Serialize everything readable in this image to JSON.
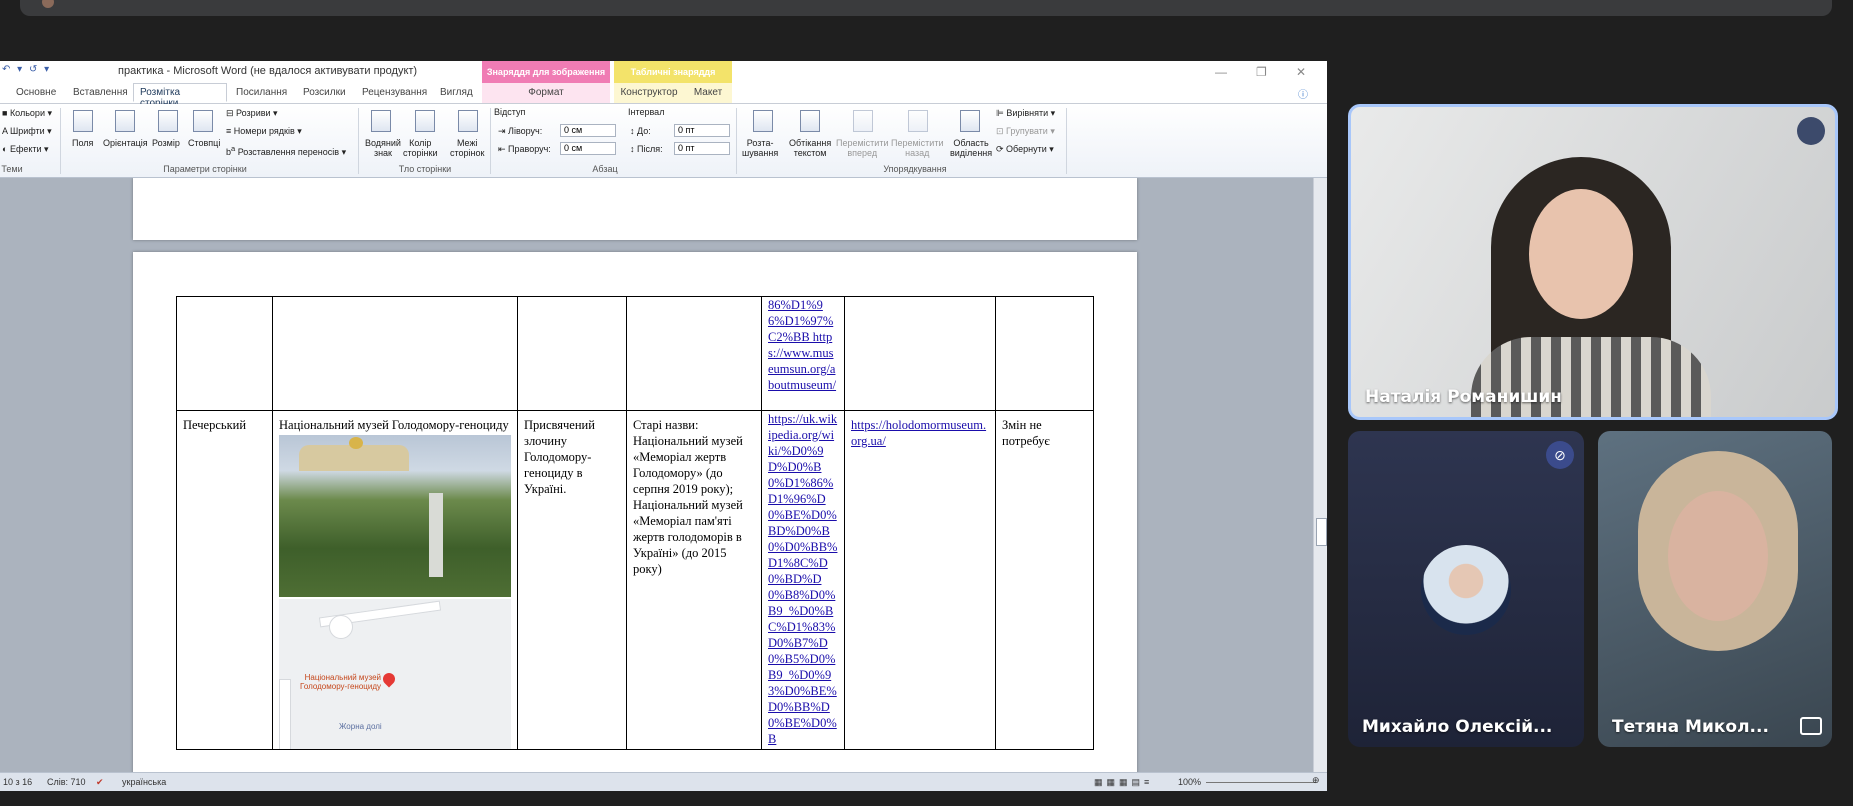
{
  "word": {
    "title": "практика - Microsoft Word (не вдалося активувати продукт)",
    "context_tabs": {
      "image_tools": "Знаряддя для зображення",
      "table_tools": "Табличні знаряддя"
    },
    "tabs": [
      "Основне",
      "Вставлення",
      "Розмітка сторінки",
      "Посилання",
      "Розсилки",
      "Рецензування",
      "Вигляд"
    ],
    "context_sub_tabs": [
      "Формат",
      "Конструктор",
      "Макет"
    ],
    "ribbon": {
      "themes": {
        "colors": "Кольори",
        "fonts": "Шрифти",
        "effects": "Ефекти",
        "group": "Теми"
      },
      "page_setup": {
        "margins": "Поля",
        "orientation": "Орієнтація",
        "size": "Розмір",
        "columns": "Стовпці",
        "breaks": "Розриви",
        "line_numbers": "Номери рядків",
        "hyphenation": "Розставлення переносів",
        "group": "Параметри сторінки"
      },
      "page_background": {
        "watermark": [
          "Водяний",
          "знак"
        ],
        "page_color": [
          "Колір",
          "сторінки"
        ],
        "page_borders": [
          "Межі",
          "сторінок"
        ],
        "group": "Тло сторінки"
      },
      "paragraph": {
        "indent_label": "Відступ",
        "left_label": "Ліворуч:",
        "left_value": "0 см",
        "right_label": "Праворуч:",
        "right_value": "0 см",
        "spacing_label": "Інтервал",
        "before_label": "До:",
        "before_value": "0 пт",
        "after_label": "Після:",
        "after_value": "0 пт",
        "group": "Абзац"
      },
      "arrange": {
        "position": [
          "Розта-",
          "шування"
        ],
        "wrap_text": [
          "Обтікання",
          "текстом"
        ],
        "bring_forward": [
          "Перемістити",
          "вперед"
        ],
        "send_backward": [
          "Перемістити",
          "назад"
        ],
        "selection_pane": [
          "Область",
          "виділення"
        ],
        "align": "Вирівняти",
        "group_btn": "Групувати",
        "rotate": "Обернути",
        "group": "Упорядкування"
      }
    },
    "table": {
      "row1": {
        "col5_link": "86%D1%96%D1%97%C2%BB https://www.museumsun.org/aboutmuseum/"
      },
      "row2": {
        "district": "Печерський",
        "name": "Національний музей Голодомору-геноциду",
        "description": "Присвячений злочину Голодомору-геноциду в Україні.",
        "old_names": "Старі назви: Національний музей «Меморіал жертв Голодомору» (до серпня 2019 року); Національний музей «Меморіал пам'яті жертв голодоморів в Україні» (до 2015 року)",
        "wiki_link": "https://uk.wikipedia.org/wiki/%D0%9D%D0%B0%D1%86%D1%96%D0%BE%D0%BD%D0%B0%D0%BB%D1%8C%D0%BD%D0%B8%D0%B9_%D0%BC%D1%83%D0%B7%D0%B5%D0%B9_%D0%93%D0%BE%D0%BB%D0%BE%D0%B",
        "site_link": "https://holodomormuseum.org.ua/",
        "status": "Змін не потребує",
        "map_label": "Національний музей Голодомору-геноциду",
        "map_label2": "Жорна долі"
      }
    },
    "status": {
      "page": "10 з 16",
      "words": "Слів: 710",
      "language": "українська",
      "zoom": "100%"
    }
  },
  "participants": [
    {
      "name": "Наталія Романишин"
    },
    {
      "name": "Михайло Олексій..."
    },
    {
      "name": "Тетяна Микол..."
    }
  ]
}
